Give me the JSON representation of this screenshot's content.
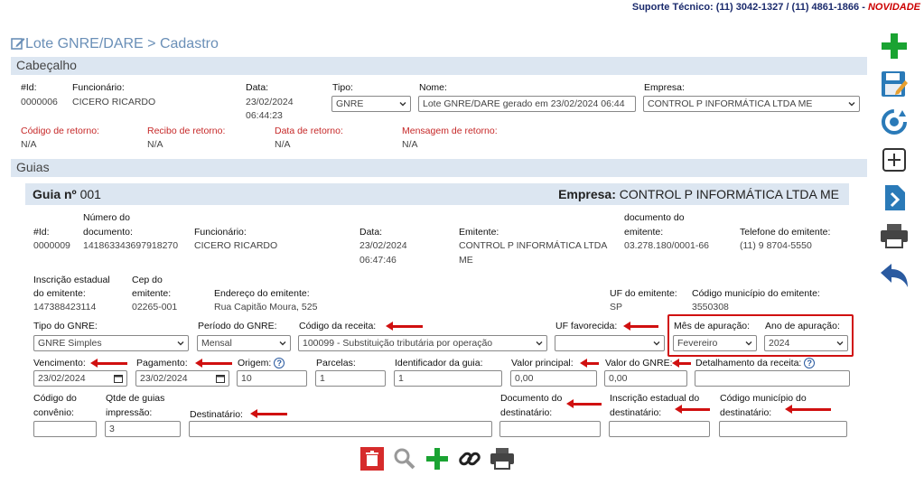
{
  "support": {
    "label": "Suporte Técnico: (11) 3042-1327 / (11) 4861-1866 - ",
    "novidades": "NOVIDADE"
  },
  "breadcrumb": "Lote GNRE/DARE > Cadastro",
  "cabecalho": {
    "section_title": "Cabeçalho",
    "id_label": "#Id:",
    "id_value": "0000006",
    "func_label": "Funcionário:",
    "func_value": "CICERO RICARDO",
    "data_label": "Data:",
    "data_value": "23/02/2024",
    "hora_value": "06:44:23",
    "tipo_label": "Tipo:",
    "tipo_value": "GNRE",
    "nome_label": "Nome:",
    "nome_value": "Lote GNRE/DARE gerado em 23/02/2024 06:44",
    "empresa_label": "Empresa:",
    "empresa_value": "CONTROL P INFORMÁTICA LTDA ME",
    "cod_ret_label": "Código de retorno:",
    "cod_ret_value": "N/A",
    "recibo_label": "Recibo de retorno:",
    "recibo_value": "N/A",
    "data_ret_label": "Data de retorno:",
    "data_ret_value": "N/A",
    "msg_label": "Mensagem de retorno:",
    "msg_value": "N/A"
  },
  "guias": {
    "section_title": "Guias",
    "guia_label": "Guia nº",
    "guia_number": "001",
    "empresa_label": "Empresa:",
    "empresa_value": "CONTROL P INFORMÁTICA LTDA ME",
    "id_label": "#Id:",
    "id_value": "0000009",
    "numdoc_label1": "Número do",
    "numdoc_label2": "documento:",
    "numdoc_value": "141863343697918270",
    "func_label": "Funcionário:",
    "func_value": "CICERO RICARDO",
    "data_label": "Data:",
    "data_value": "23/02/2024",
    "hora_value": "06:47:46",
    "emit_label": "Emitente:",
    "emit_value1": "CONTROL P INFORMÁTICA LTDA",
    "emit_value2": "ME",
    "docemit_label1": "documento do",
    "docemit_label2": "emitente:",
    "docemit_value": "03.278.180/0001-66",
    "tel_label": "Telefone do emitente:",
    "tel_value": "(11) 9 8704-5550",
    "ie_label1": "Inscrição estadual",
    "ie_label2": "do emitente:",
    "ie_value": "147388423114",
    "cep_label1": "Cep do",
    "cep_label2": "emitente:",
    "cep_value": "02265-001",
    "end_label": "Endereço do emitente:",
    "end_value": "Rua Capitão Moura, 525",
    "uf_label": "UF do emitente:",
    "uf_value": "SP",
    "codmun_label": "Código município do emitente:",
    "codmun_value": "3550308",
    "tipo_gnre_label": "Tipo do GNRE:",
    "tipo_gnre_value": "GNRE Simples",
    "periodo_label": "Período do GNRE:",
    "periodo_value": "Mensal",
    "receita_label": "Código da receita:",
    "receita_value": "100099 - Substituição tributária por operação",
    "uf_fav_label": "UF favorecida:",
    "uf_fav_value": "",
    "mes_label": "Mês de apuração:",
    "mes_value": "Fevereiro",
    "ano_label": "Ano de apuração:",
    "ano_value": "2024",
    "venc_label": "Vencimento:",
    "venc_value": "23/02/2024",
    "pag_label": "Pagamento:",
    "pag_value": "23/02/2024",
    "origem_label": "Origem:",
    "origem_value": "10",
    "parcelas_label": "Parcelas:",
    "parcelas_value": "1",
    "ident_label": "Identificador da guia:",
    "ident_value": "1",
    "valor_principal_label": "Valor principal:",
    "valor_principal_value": "0,00",
    "valor_gnre_label": "Valor do GNRE:",
    "valor_gnre_value": "0,00",
    "detalhamento_label": "Detalhamento da receita:",
    "detalhamento_value": "",
    "conv_label1": "Código do",
    "conv_label2": "convênio:",
    "conv_value": "",
    "qtde_label1": "Qtde de guias",
    "qtde_label2": "impressão:",
    "qtde_value": "3",
    "dest_label": "Destinatário:",
    "dest_value": "",
    "docdest_label1": "Documento do",
    "docdest_label2": "destinatário:",
    "docdest_value": "",
    "iedest_label1": "Inscrição estadual do",
    "iedest_label2": "destinatário:",
    "iedest_value": "",
    "codmundest_label1": "Código município do",
    "codmundest_label2": "destinatário:",
    "codmundest_value": ""
  },
  "icons": {
    "side": [
      "add-icon",
      "save-icon",
      "refresh-icon",
      "new-window-icon",
      "export-icon",
      "print-icon",
      "back-icon"
    ],
    "bottom": [
      "delete-icon",
      "search-icon",
      "add-icon",
      "link-icon",
      "print-icon"
    ]
  },
  "colors": {
    "accent": "#2a7ab8",
    "green": "#1aa332",
    "red_label": "#c62828",
    "bar": "#dce6f1"
  }
}
